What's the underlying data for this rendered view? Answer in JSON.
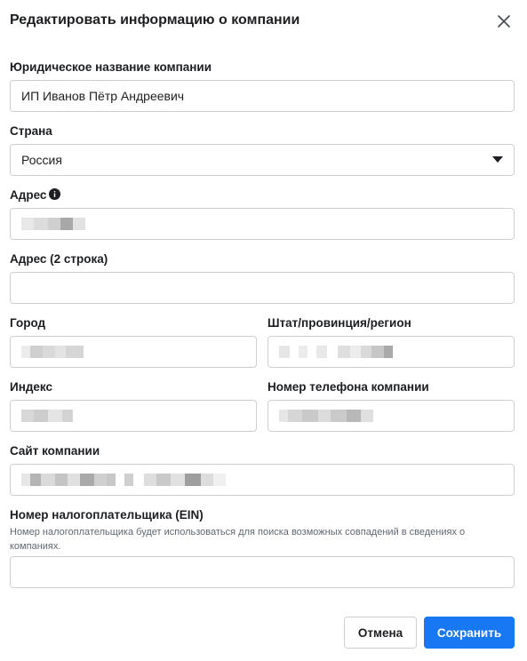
{
  "dialog": {
    "title": "Редактировать информацию о компании"
  },
  "form": {
    "legal_name": {
      "label": "Юридическое название компании",
      "value": "ИП Иванов Пётр Андреевич"
    },
    "country": {
      "label": "Страна",
      "value": "Россия"
    },
    "address": {
      "label": "Адрес",
      "value": ""
    },
    "address2": {
      "label": "Адрес (2 строка)",
      "value": ""
    },
    "city": {
      "label": "Город",
      "value": ""
    },
    "state": {
      "label": "Штат/провинция/регион",
      "value": ""
    },
    "zip": {
      "label": "Индекс",
      "value": ""
    },
    "phone": {
      "label": "Номер телефона компании",
      "value": ""
    },
    "website": {
      "label": "Сайт компании",
      "value": ""
    },
    "ein": {
      "label": "Номер налогоплательщика (EIN)",
      "hint": "Номер налогоплательщика будет использоваться для поиска возможных совпадений в сведениях о компаниях.",
      "value": ""
    }
  },
  "buttons": {
    "cancel": "Отмена",
    "save": "Сохранить"
  },
  "icons": {
    "close": "close-icon",
    "info": "info-icon",
    "dropdown": "caret-down-icon"
  },
  "colors": {
    "primary": "#1877f2",
    "border": "#ccd0d5"
  }
}
